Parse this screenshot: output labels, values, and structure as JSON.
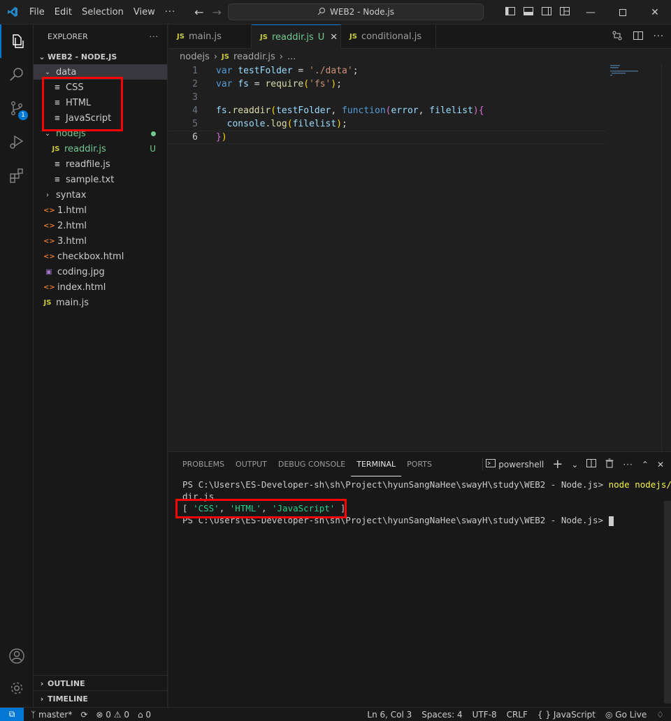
{
  "window": {
    "title": "WEB2 - Node.js",
    "menu": [
      "File",
      "Edit",
      "Selection",
      "View",
      "···"
    ]
  },
  "colors": {
    "accent": "#0078d4",
    "highlight": "#ff0000",
    "untracked": "#73c991"
  },
  "activity": {
    "scm_badge": "1"
  },
  "explorer": {
    "header": "EXPLORER",
    "root": "WEB2 - NODE.JS",
    "items": [
      {
        "label": "data",
        "type": "folder",
        "open": true,
        "icon": "chevron-down-icon"
      },
      {
        "label": "CSS",
        "type": "file",
        "icon": "file-lines-icon"
      },
      {
        "label": "HTML",
        "type": "file",
        "icon": "file-lines-icon"
      },
      {
        "label": "JavaScript",
        "type": "file",
        "icon": "file-lines-icon"
      },
      {
        "label": "nodejs",
        "type": "folder",
        "open": true,
        "icon": "chevron-down-icon"
      },
      {
        "label": "readdir.js",
        "type": "js",
        "suffix": "U"
      },
      {
        "label": "readfile.js",
        "type": "js"
      },
      {
        "label": "sample.txt",
        "type": "txt"
      },
      {
        "label": "syntax",
        "type": "folder",
        "open": false
      },
      {
        "label": "1.html",
        "type": "html"
      },
      {
        "label": "2.html",
        "type": "html"
      },
      {
        "label": "3.html",
        "type": "html"
      },
      {
        "label": "checkbox.html",
        "type": "html"
      },
      {
        "label": "coding.jpg",
        "type": "image"
      },
      {
        "label": "index.html",
        "type": "html"
      },
      {
        "label": "main.js",
        "type": "js"
      }
    ],
    "outline": "OUTLINE",
    "timeline": "TIMELINE"
  },
  "tabs": [
    {
      "label": "main.js",
      "active": false,
      "badge": "JS"
    },
    {
      "label": "readdir.js",
      "active": true,
      "badge": "JS",
      "status": "U"
    },
    {
      "label": "conditional.js",
      "active": false,
      "badge": "JS"
    }
  ],
  "breadcrumb": {
    "folder": "nodejs",
    "file": "readdir.js",
    "more": "..."
  },
  "editor": {
    "line_numbers": [
      "1",
      "2",
      "3",
      "4",
      "5",
      "6"
    ],
    "lines": [
      "var testFolder = './data';",
      "var fs = require('fs');",
      "",
      "fs.readdir(testFolder, function(error, filelist){",
      "  console.log(filelist);",
      "})"
    ]
  },
  "panel": {
    "tabs": [
      "PROBLEMS",
      "OUTPUT",
      "DEBUG CONSOLE",
      "TERMINAL",
      "PORTS"
    ],
    "active_tab": "TERMINAL",
    "shell": "powershell",
    "terminal": {
      "prompt1": "PS C:\\Users\\ES-Developer-sh\\sh\\Project\\hyunSangNaHee\\swayH\\study\\WEB2 - Node.js> ",
      "command": "node nodejs/read",
      "command_wrap": "dir.js",
      "output": [
        "CSS",
        "HTML",
        "JavaScript"
      ],
      "prompt2": "PS C:\\Users\\ES-Developer-sh\\sh\\Project\\hyunSangNaHee\\swayH\\study\\WEB2 - Node.js> "
    }
  },
  "status": {
    "branch": "master*",
    "errors": "0",
    "warnings": "0",
    "ports": "0",
    "position": "Ln 6, Col 3",
    "spaces": "Spaces: 4",
    "encoding": "UTF-8",
    "eol": "CRLF",
    "language": "JavaScript",
    "golive": "Go Live"
  }
}
